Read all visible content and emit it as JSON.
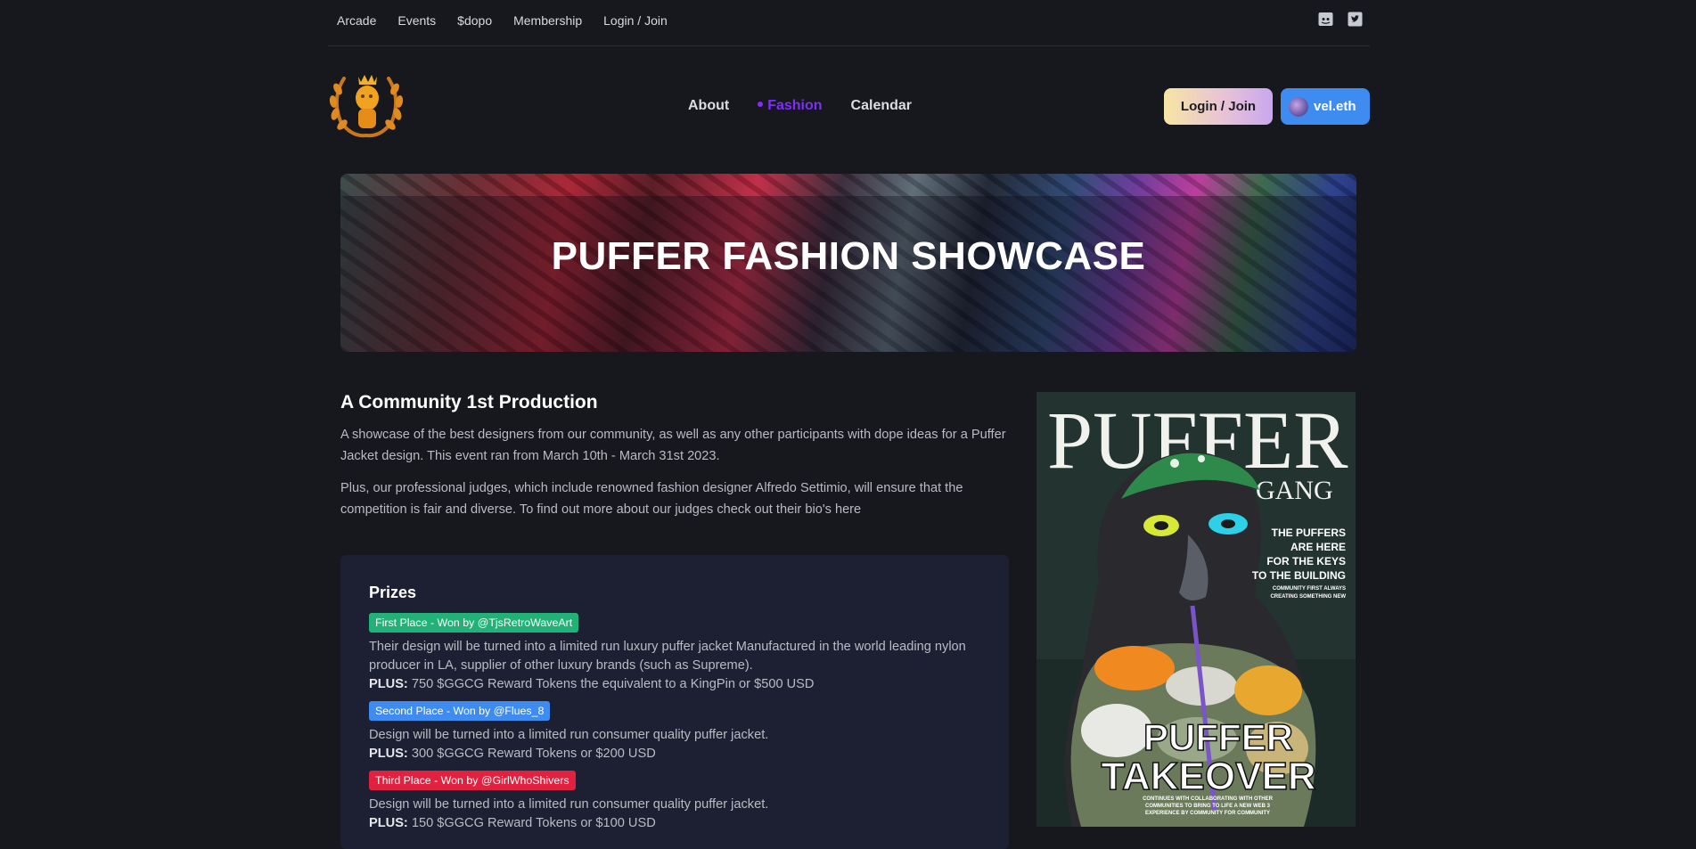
{
  "topbar": {
    "links": [
      "Arcade",
      "Events",
      "$dopo",
      "Membership",
      "Login / Join"
    ]
  },
  "icons": {
    "discord": "discord-icon",
    "twitter": "twitter-icon",
    "logo": "crowned-puffer-laurel-logo"
  },
  "nav": {
    "about": "About",
    "fashion": "Fashion",
    "calendar": "Calendar"
  },
  "header": {
    "login_label": "Login / Join",
    "wallet_label": "vel.eth"
  },
  "banner": {
    "title": "PUFFER FASHION SHOWCASE"
  },
  "intro": {
    "title": "A Community 1st Production",
    "para1": "A showcase of the best designers from our community, as well as any other participants with dope ideas for a Puffer Jacket design. This event ran from March 10th - March 31st 2023.",
    "para2": "Plus, our professional judges, which include renowned fashion designer Alfredo Settimio, will ensure that the competition is fair and diverse. To find out more about our judges check out their bio's here"
  },
  "prizes": {
    "title": "Prizes",
    "first": {
      "badge": "First Place - Won by @TjsRetroWaveArt",
      "text": "Their design will be turned into a limited run luxury puffer jacket Manufactured in the world leading nylon producer in LA, supplier of other luxury brands (such as Supreme).",
      "plus_label": "PLUS:",
      "plus_text": " 750 $GGCG Reward Tokens the equivalent to a KingPin or $500 USD"
    },
    "second": {
      "badge": "Second Place - Won by @Flues_8",
      "text": "Design will be turned into a limited run consumer quality puffer jacket.",
      "plus_label": "PLUS:",
      "plus_text": " 300 $GGCG Reward Tokens or $200 USD"
    },
    "third": {
      "badge": "Third Place - Won by @GirlWhoShivers",
      "text": "Design will be turned into a limited run consumer quality puffer jacket.",
      "plus_label": "PLUS:",
      "plus_text": " 150 $GGCG Reward Tokens or $100 USD"
    }
  },
  "cover": {
    "masthead": "PUFFER",
    "subhead": "GANG",
    "tagline1": "THE PUFFERS",
    "tagline2": "ARE HERE",
    "tagline3": "FOR THE KEYS",
    "tagline4": "TO THE BUILDING",
    "small1": "COMMUNITY FIRST ALWAYS",
    "small2": "CREATING SOMETHING NEW",
    "headline1": "PUFFER",
    "headline2": "TAKEOVER",
    "foot1": "CONTINUES  WITH COLLABORATING WITH OTHER",
    "foot2": "COMMUNITIES TO BRING TO LIFE A NEW WEB 3",
    "foot3": "EXPERIENCE BY COMMUNITY FOR COMMUNITY"
  },
  "colors": {
    "background": "#17181d",
    "accent": "#7d2ff5",
    "first": "#22b177",
    "second": "#3f8cf0",
    "third": "#e0213f",
    "prizes_panel": "#1d2032"
  }
}
